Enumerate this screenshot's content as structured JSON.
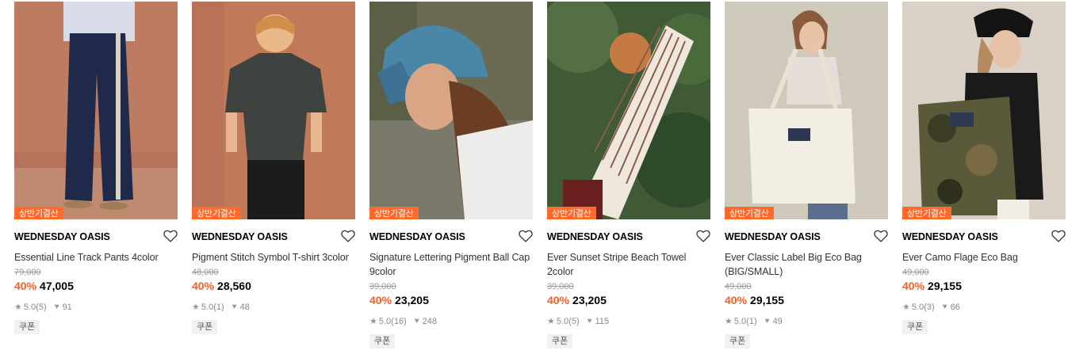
{
  "products": [
    {
      "badge": "상반기결산",
      "brand": "WEDNESDAY OASIS",
      "name": "Essential Line Track Pants 4color",
      "original_price": "79,000",
      "discount": "40%",
      "price": "47,005",
      "rating": "5.0",
      "review_count": "(5)",
      "likes": "91",
      "coupon": "쿠폰",
      "image": "model wearing navy track pants with side stripe against terracotta wall"
    },
    {
      "badge": "상반기결산",
      "brand": "WEDNESDAY OASIS",
      "name": "Pigment Stitch Symbol T-shirt 3color",
      "original_price": "48,000",
      "discount": "40%",
      "price": "28,560",
      "rating": "5.0",
      "review_count": "(1)",
      "likes": "48",
      "coupon": "쿠폰",
      "image": "model wearing charcoal pigment t-shirt against terracotta wall"
    },
    {
      "badge": "상반기결산",
      "brand": "WEDNESDAY OASIS",
      "name": "Signature Lettering Pigment Ball Cap 9color",
      "original_price": "39,000",
      "discount": "40%",
      "price": "23,205",
      "rating": "5.0",
      "review_count": "(16)",
      "likes": "248",
      "coupon": "쿠폰",
      "image": "model wearing blue lettering ball cap by window"
    },
    {
      "badge": "상반기결산",
      "brand": "WEDNESDAY OASIS",
      "name": "Ever Sunset Stripe Beach Towel 2color",
      "original_price": "39,000",
      "discount": "40%",
      "price": "23,205",
      "rating": "5.0",
      "review_count": "(5)",
      "likes": "115",
      "coupon": "쿠폰",
      "image": "model holding striped beach towel among palm plants"
    },
    {
      "badge": "상반기결산",
      "brand": "WEDNESDAY OASIS",
      "name": "Ever Classic Label Big Eco Bag (BIG/SMALL)",
      "original_price": "49,000",
      "discount": "40%",
      "price": "29,155",
      "rating": "5.0",
      "review_count": "(1)",
      "likes": "49",
      "coupon": "쿠폰",
      "image": "model carrying cream eco bag against beige wall"
    },
    {
      "badge": "상반기결산",
      "brand": "WEDNESDAY OASIS",
      "name": "Ever Camo Flage Eco Bag",
      "original_price": "49,000",
      "discount": "40%",
      "price": "29,155",
      "rating": "5.0",
      "review_count": "(3)",
      "likes": "66",
      "coupon": "쿠폰",
      "image": "model with black cap carrying camouflage eco bag"
    }
  ],
  "colors": {
    "badge_bg": "#ff6a2c",
    "discount": "#ff5a1f",
    "muted": "#999999"
  },
  "icons": {
    "wish": "heart-outline-icon",
    "rating": "star-icon",
    "likes": "heart-filled-icon"
  }
}
